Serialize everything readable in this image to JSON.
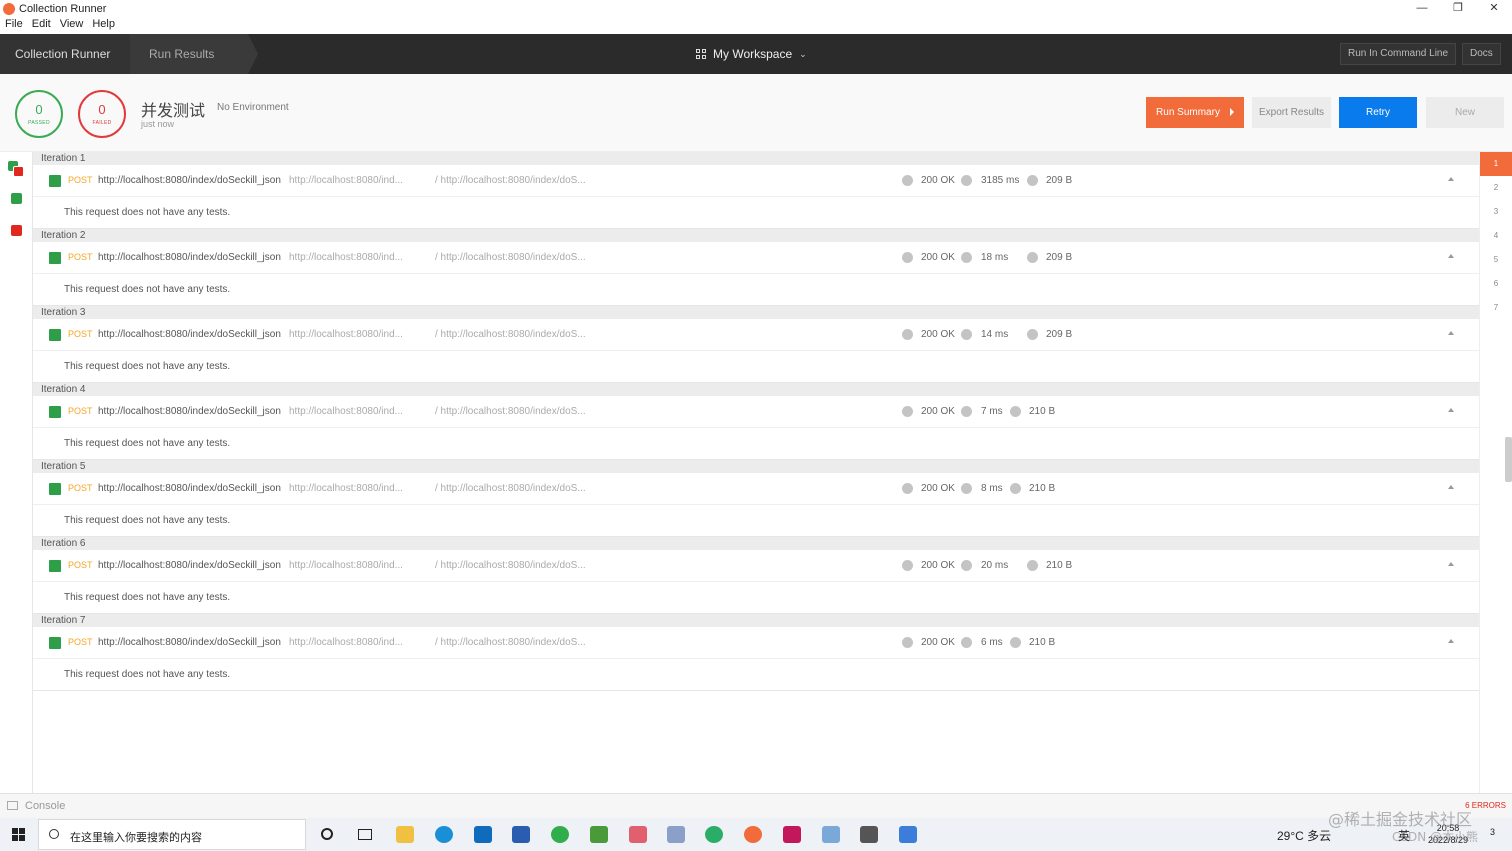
{
  "window": {
    "title": "Collection Runner",
    "minimize": "—",
    "restore": "❐",
    "close": "✕"
  },
  "menu": [
    "File",
    "Edit",
    "View",
    "Help"
  ],
  "header": {
    "crumbs": [
      "Collection Runner",
      "Run Results"
    ],
    "workspace": "My Workspace",
    "cli_button": "Run In Command Line",
    "docs_button": "Docs"
  },
  "summary": {
    "passed_count": "0",
    "passed_label": "PASSED",
    "failed_count": "0",
    "failed_label": "FAILED",
    "collection_name": "并发测试",
    "environment": "No Environment",
    "run_time": "just now",
    "buttons": {
      "run_summary": "Run Summary",
      "export": "Export Results",
      "retry": "Retry",
      "new": "New"
    }
  },
  "iterations": [
    {
      "label": "Iteration 1",
      "method": "POST",
      "url": "http://localhost:8080/index/doSeckill_json",
      "url_short": "http://localhost:8080/ind...",
      "path": "/ http://localhost:8080/index/doS...",
      "status": "200 OK",
      "time": "3185 ms",
      "size": "209 B",
      "note": "This request does not have any tests."
    },
    {
      "label": "Iteration 2",
      "method": "POST",
      "url": "http://localhost:8080/index/doSeckill_json",
      "url_short": "http://localhost:8080/ind...",
      "path": "/ http://localhost:8080/index/doS...",
      "status": "200 OK",
      "time": "18 ms",
      "size": "209 B",
      "note": "This request does not have any tests."
    },
    {
      "label": "Iteration 3",
      "method": "POST",
      "url": "http://localhost:8080/index/doSeckill_json",
      "url_short": "http://localhost:8080/ind...",
      "path": "/ http://localhost:8080/index/doS...",
      "status": "200 OK",
      "time": "14 ms",
      "size": "209 B",
      "note": "This request does not have any tests."
    },
    {
      "label": "Iteration 4",
      "method": "POST",
      "url": "http://localhost:8080/index/doSeckill_json",
      "url_short": "http://localhost:8080/ind...",
      "path": "/ http://localhost:8080/index/doS...",
      "status": "200 OK",
      "time": "7 ms",
      "size": "210 B",
      "note": "This request does not have any tests."
    },
    {
      "label": "Iteration 5",
      "method": "POST",
      "url": "http://localhost:8080/index/doSeckill_json",
      "url_short": "http://localhost:8080/ind...",
      "path": "/ http://localhost:8080/index/doS...",
      "status": "200 OK",
      "time": "8 ms",
      "size": "210 B",
      "note": "This request does not have any tests."
    },
    {
      "label": "Iteration 6",
      "method": "POST",
      "url": "http://localhost:8080/index/doSeckill_json",
      "url_short": "http://localhost:8080/ind...",
      "path": "/ http://localhost:8080/index/doS...",
      "status": "200 OK",
      "time": "20 ms",
      "size": "210 B",
      "note": "This request does not have any tests."
    },
    {
      "label": "Iteration 7",
      "method": "POST",
      "url": "http://localhost:8080/index/doSeckill_json",
      "url_short": "http://localhost:8080/ind...",
      "path": "/ http://localhost:8080/index/doS...",
      "status": "200 OK",
      "time": "6 ms",
      "size": "210 B",
      "note": "This request does not have any tests."
    }
  ],
  "iteration_nav": [
    "1",
    "2",
    "3",
    "4",
    "5",
    "6",
    "7"
  ],
  "console": {
    "label": "Console",
    "errors": "6 ERRORS"
  },
  "taskbar": {
    "search_placeholder": "在这里输入你要搜索的内容",
    "weather": "29°C 多云",
    "ime": "英",
    "time": "20:58",
    "date": "2022/8/29",
    "notifications": "3"
  },
  "watermark": {
    "line1": "@稀土掘金技术社区",
    "line2": "CSDN @本小熊"
  },
  "colors": {
    "accent": "#f26b3a",
    "retry": "#097bed",
    "pass": "#2e9e49",
    "fail": "#e0281e",
    "method": "#f5a623"
  }
}
